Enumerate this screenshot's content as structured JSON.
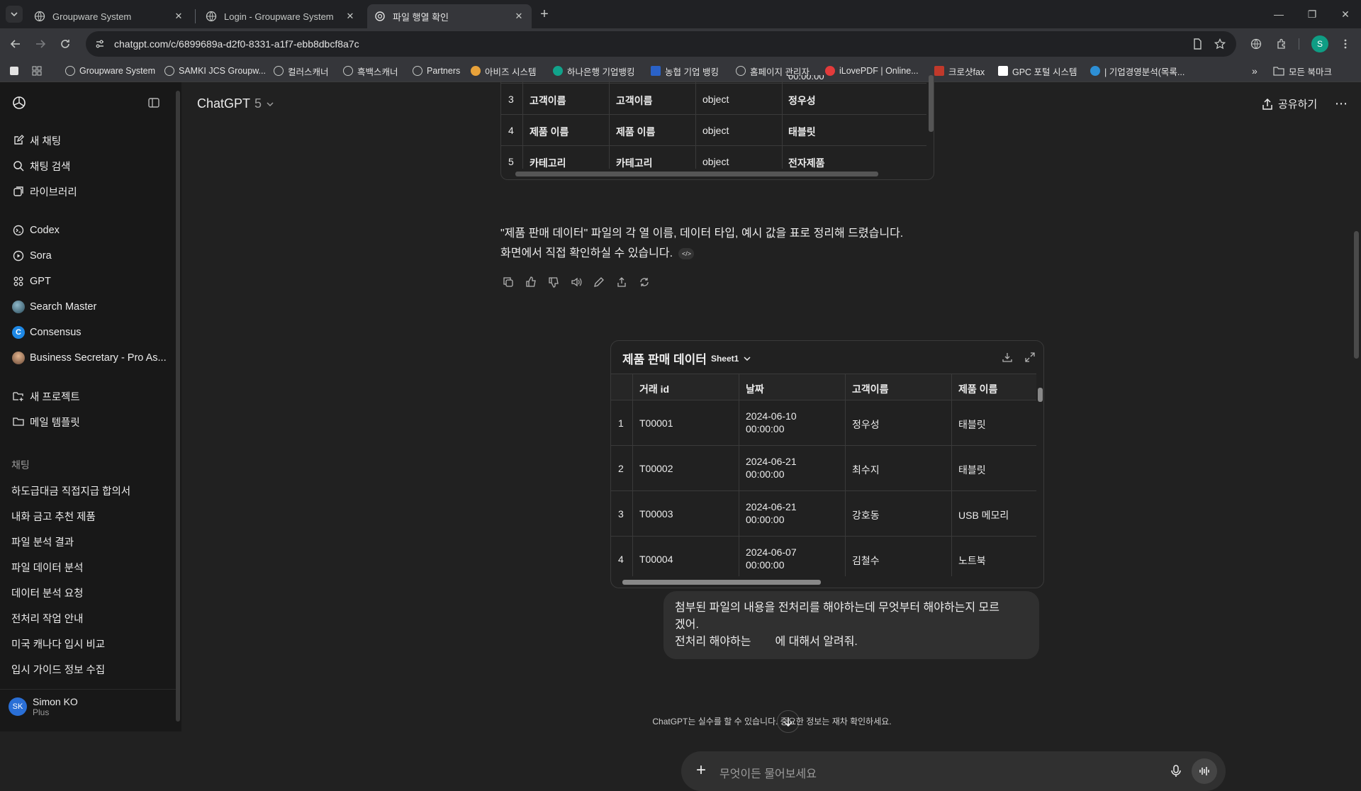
{
  "browser": {
    "tabs": [
      {
        "title": "Groupware System",
        "active": false
      },
      {
        "title": "Login - Groupware System",
        "active": false
      },
      {
        "title": "파일 행열 확인",
        "active": true
      }
    ],
    "url": "chatgpt.com/c/6899689a-d2f0-8331-a1f7-ebb8dbcf8a7c",
    "profile_initial": "S",
    "bookmarks": [
      "Groupware System",
      "SAMKI JCS Groupw...",
      "컬러스캐너",
      "흑백스캐너",
      "Partners",
      "아비즈 시스템",
      "하나은행 기업뱅킹",
      "농협 기업 뱅킹",
      "홈페이지 관리자",
      "iLovePDF | Online...",
      "크로샷fax",
      "GPC 포털 시스템",
      "| 기업경영분석(목록..."
    ],
    "all_bookmarks": "모든 북마크"
  },
  "sidebar": {
    "top_items": [
      {
        "label": "새 채팅",
        "icon": "new-chat-icon"
      },
      {
        "label": "채팅 검색",
        "icon": "search-icon"
      },
      {
        "label": "라이브러리",
        "icon": "library-icon"
      }
    ],
    "app_items": [
      {
        "label": "Codex",
        "icon": "codex-icon"
      },
      {
        "label": "Sora",
        "icon": "sora-icon"
      },
      {
        "label": "GPT",
        "icon": "gpt-icon"
      },
      {
        "label": "Search Master",
        "icon": "search-master-icon"
      },
      {
        "label": "Consensus",
        "icon": "consensus-icon"
      },
      {
        "label": "Business Secretary - Pro As...",
        "icon": "business-secretary-icon"
      }
    ],
    "project_items": [
      {
        "label": "새 프로젝트",
        "icon": "new-project-icon"
      },
      {
        "label": "메일 템플릿",
        "icon": "folder-icon"
      }
    ],
    "section_label": "채팅",
    "chats": [
      "하도급대금 직접지급 합의서",
      "내화 금고 추천 제품",
      "파일 분석 결과",
      "파일 데이터 분석",
      "데이터 분석 요청",
      "전처리 작업 안내",
      "미국 캐나다 입시 비교",
      "입시 가이드 정보 수집"
    ],
    "user": {
      "initials": "SK",
      "name": "Simon KO",
      "plan": "Plus"
    }
  },
  "header": {
    "model": "ChatGPT",
    "version": "5",
    "share": "공유하기"
  },
  "top_table": {
    "partial_top": "00:00:00",
    "rows": [
      {
        "num": "3",
        "col": "고객이름",
        "name": "고객이름",
        "type": "object",
        "example": "정우성"
      },
      {
        "num": "4",
        "col": "제품 이름",
        "name": "제품 이름",
        "type": "object",
        "example": "태블릿"
      },
      {
        "num": "5",
        "col": "카테고리",
        "name": "카테고리",
        "type": "object",
        "example": "전자제품"
      }
    ]
  },
  "assistant": {
    "line1": "\"제품 판매 데이터\" 파일의 각 열 이름, 데이터 타입, 예시 값을 표로 정리해 드렸습니다.",
    "line2": "화면에서 직접 확인하실 수 있습니다.",
    "code_badge": "</>"
  },
  "sheet": {
    "title": "제품 판매 데이터",
    "sheet_name": "Sheet1",
    "headers": [
      "거래 id",
      "날짜",
      "고객이름",
      "제품 이름"
    ],
    "rows": [
      {
        "num": "1",
        "id": "T00001",
        "date": "2024-06-10",
        "time": "00:00:00",
        "customer": "정우성",
        "product": "태블릿"
      },
      {
        "num": "2",
        "id": "T00002",
        "date": "2024-06-21",
        "time": "00:00:00",
        "customer": "최수지",
        "product": "태블릿"
      },
      {
        "num": "3",
        "id": "T00003",
        "date": "2024-06-21",
        "time": "00:00:00",
        "customer": "강호동",
        "product": "USB 메모리"
      },
      {
        "num": "4",
        "id": "T00004",
        "date": "2024-06-07",
        "time": "00:00:00",
        "customer": "김철수",
        "product": "노트북"
      }
    ]
  },
  "user_message": {
    "line1": "첨부된 파일의 내용을 전처리를 해야하는데 무엇부터 해야하는지 모르",
    "line2": "겠어.",
    "line3a": "전처리 해야하는",
    "line3b": "에 대해서 알려줘."
  },
  "composer": {
    "placeholder": "무엇이든 물어보세요"
  },
  "disclaimer": "ChatGPT는 실수를 할 수 있습니다. 중요한 정보는 재차 확인하세요."
}
